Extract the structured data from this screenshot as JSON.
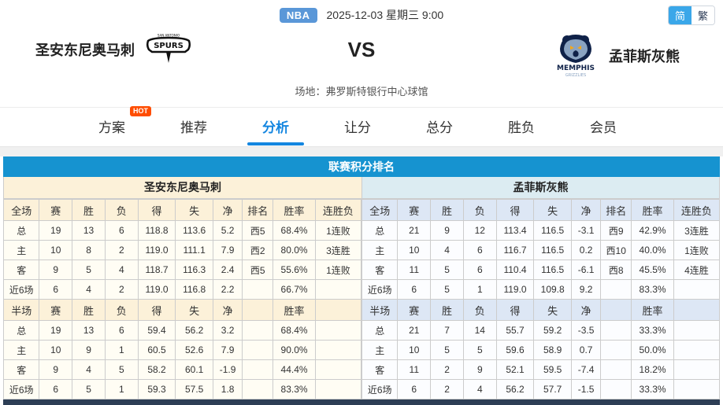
{
  "top_bar": {
    "league_badge": "NBA",
    "datetime": "2025-12-03 星期三 9:00",
    "lang": {
      "simplified": "简",
      "traditional": "繁"
    }
  },
  "header": {
    "home_team": "圣安东尼奥马刺",
    "vs": "VS",
    "away_team": "孟菲斯灰熊",
    "venue": "场地：弗罗斯特银行中心球馆",
    "home_logo_text": "SPURS",
    "away_logo_text": "MEMPHIS",
    "away_logo_subtext": "GRIZZLIES"
  },
  "nav": {
    "tabs": [
      {
        "key": "fangan",
        "label": "方案",
        "hot": "HOT",
        "active": false
      },
      {
        "key": "tuijian",
        "label": "推荐",
        "active": false
      },
      {
        "key": "fenxi",
        "label": "分析",
        "active": true
      },
      {
        "key": "rangfen",
        "label": "让分",
        "active": false
      },
      {
        "key": "zongfen",
        "label": "总分",
        "active": false
      },
      {
        "key": "shengfu",
        "label": "胜负",
        "active": false
      },
      {
        "key": "huiyuan",
        "label": "会员",
        "active": false
      }
    ]
  },
  "standings": {
    "title": "联赛积分排名",
    "full_headers": [
      "全场",
      "赛",
      "胜",
      "负",
      "得",
      "失",
      "净",
      "排名",
      "胜率",
      "连胜负"
    ],
    "half_headers": [
      "半场",
      "赛",
      "胜",
      "负",
      "得",
      "失",
      "净",
      "",
      "胜率",
      ""
    ],
    "colors": {
      "accent_blue": "#1693d0",
      "stat_red": "#ee2222",
      "streak_win_red": "#ee2222",
      "streak_loss_green": "#18a018",
      "home_header_bg": "#fcf1d9",
      "away_header_bg": "#dde7f5"
    },
    "home": {
      "name": "圣安东尼奥马刺",
      "full": [
        [
          "总",
          "19",
          "13",
          "6",
          "118.8",
          "113.6",
          "5.2",
          "西5",
          "68.4%",
          "1连败"
        ],
        [
          "主",
          "10",
          "8",
          "2",
          "119.0",
          "111.1",
          "7.9",
          "西2",
          "80.0%",
          "3连胜"
        ],
        [
          "客",
          "9",
          "5",
          "4",
          "118.7",
          "116.3",
          "2.4",
          "西5",
          "55.6%",
          "1连败"
        ],
        [
          "近6场",
          "6",
          "4",
          "2",
          "119.0",
          "116.8",
          "2.2",
          "",
          "66.7%",
          ""
        ]
      ],
      "half": [
        [
          "总",
          "19",
          "13",
          "6",
          "59.4",
          "56.2",
          "3.2",
          "",
          "68.4%",
          ""
        ],
        [
          "主",
          "10",
          "9",
          "1",
          "60.5",
          "52.6",
          "7.9",
          "",
          "90.0%",
          ""
        ],
        [
          "客",
          "9",
          "4",
          "5",
          "58.2",
          "60.1",
          "-1.9",
          "",
          "44.4%",
          ""
        ],
        [
          "近6场",
          "6",
          "5",
          "1",
          "59.3",
          "57.5",
          "1.8",
          "",
          "83.3%",
          ""
        ]
      ]
    },
    "away": {
      "name": "孟菲斯灰熊",
      "full": [
        [
          "总",
          "21",
          "9",
          "12",
          "113.4",
          "116.5",
          "-3.1",
          "西9",
          "42.9%",
          "3连胜"
        ],
        [
          "主",
          "10",
          "4",
          "6",
          "116.7",
          "116.5",
          "0.2",
          "西10",
          "40.0%",
          "1连败"
        ],
        [
          "客",
          "11",
          "5",
          "6",
          "110.4",
          "116.5",
          "-6.1",
          "西8",
          "45.5%",
          "4连胜"
        ],
        [
          "近6场",
          "6",
          "5",
          "1",
          "119.0",
          "109.8",
          "9.2",
          "",
          "83.3%",
          ""
        ]
      ],
      "half": [
        [
          "总",
          "21",
          "7",
          "14",
          "55.7",
          "59.2",
          "-3.5",
          "",
          "33.3%",
          ""
        ],
        [
          "主",
          "10",
          "5",
          "5",
          "59.6",
          "58.9",
          "0.7",
          "",
          "50.0%",
          ""
        ],
        [
          "客",
          "11",
          "2",
          "9",
          "52.1",
          "59.5",
          "-7.4",
          "",
          "18.2%",
          ""
        ],
        [
          "近6场",
          "6",
          "2",
          "4",
          "56.2",
          "57.7",
          "-1.5",
          "",
          "33.3%",
          ""
        ]
      ]
    }
  }
}
